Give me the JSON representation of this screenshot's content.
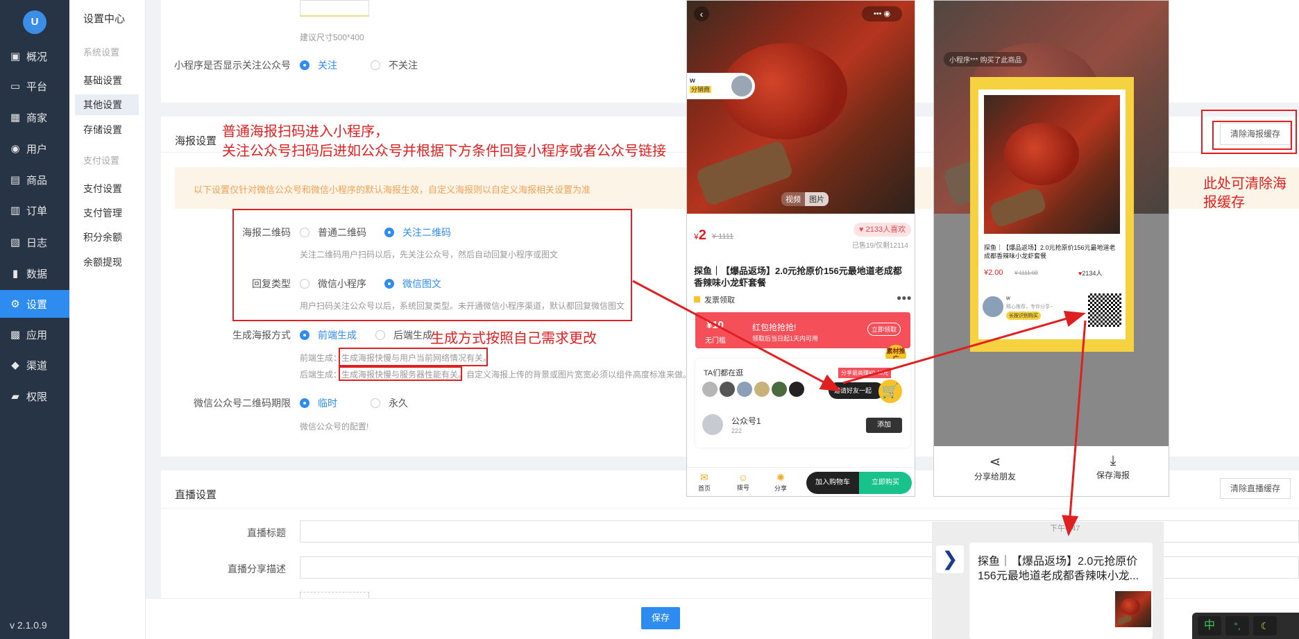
{
  "app": {
    "logo": "U",
    "version": "v 2.1.0.9"
  },
  "nav": [
    "概况",
    "平台",
    "商家",
    "用户",
    "商品",
    "订单",
    "日志",
    "数据",
    "设置",
    "应用",
    "渠道",
    "权限"
  ],
  "nav_icons": [
    "dashboard-icon",
    "monitor-icon",
    "store-icon",
    "user-icon",
    "goods-icon",
    "order-icon",
    "log-icon",
    "chart-icon",
    "gear-icon",
    "apps-icon",
    "cube-icon",
    "lock-icon"
  ],
  "sub": {
    "title": "设置中心",
    "group1": "系统设置",
    "items1": [
      "基础设置",
      "其他设置",
      "存储设置"
    ],
    "group2": "支付设置",
    "items2": [
      "支付设置",
      "支付管理",
      "积分余额",
      "余额提现"
    ]
  },
  "top": {
    "size_hint": "建议尺寸500*400",
    "follow_label": "小程序是否显示关注公众号",
    "follow_on": "关注",
    "follow_off": "不关注"
  },
  "poster": {
    "title": "海报设置",
    "clear_button": "清除海报缓存",
    "notice": "以下设置仅针对微信公众号和微信小程序的默认海报生效，自定义海报则以自定义海报相关设置为准",
    "qr_label": "海报二维码",
    "qr_opt1": "普通二维码",
    "qr_opt2": "关注二维码",
    "qr_hint": "关注二维码用户扫码以后，先关注公众号，然后自动回复小程序或图文",
    "reply_label": "回复类型",
    "reply_opt1": "微信小程序",
    "reply_opt2": "微信图文",
    "reply_hint": "用户扫码关注公众号以后，系统回复类型。未开通微信小程序渠道，默认都回复微信图文",
    "gen_label": "生成海报方式",
    "gen_opt1": "前端生成",
    "gen_opt2": "后端生成",
    "gen_hint1_prefix": "前端生成：",
    "gen_hint1": "生成海报快慢与用户当前网络情况有关。",
    "gen_hint2_prefix": "后端生成：",
    "gen_hint2": "生成海报快慢与服务器性能有关。",
    "gen_hint2_suffix": "自定义海报上传的背景或图片宽宽必须以组件高度标准来做。",
    "exp_label": "微信公众号二维码期限",
    "exp_opt1": "临时",
    "exp_opt2": "永久",
    "exp_hint": "微信公众号的配置!"
  },
  "live": {
    "title": "直播设置",
    "clear_button": "清除直播缓存",
    "title_label": "直播标题",
    "desc_label": "直播分享描述"
  },
  "save_button": "保存",
  "annotations": {
    "a1_line1": "普通海报扫码进入小程序，",
    "a1_line2": "关注公众号扫码后进如公众号并根据下方条件回复小程序或者公众号链接",
    "a2": "生成方式按照自己需求更改",
    "a3_line1": "此处可清除海",
    "a3_line2": "报缓存"
  },
  "phone1": {
    "user": "w",
    "tag": "分销商",
    "media_tabs": [
      "视频",
      "图片"
    ],
    "price_sym": "¥",
    "price": "2",
    "orig_price": "¥ 1111",
    "likes": "2133人喜欢",
    "sold": "已售19/仅剩12114",
    "product_title": "探鱼｜【爆品返场】2.0元抢原价156元最地道老成都香辣味小龙虾套餐",
    "invoice": "发票领取",
    "coupon_value": "¥10",
    "coupon_type": "无门槛",
    "coupon_title": "红包抢抢抢!",
    "coupon_desc": "领取后当日起1天内可用",
    "coupon_btn": "立即领取",
    "material": "素材推广",
    "others": "TA们都在逛",
    "share_earn": "分享最高赚¥0.40元",
    "invite": "邀请好友一起",
    "account": "公众号1",
    "account_num": "222",
    "add_btn": "添加",
    "bottom": [
      "首页",
      "拨号",
      "分享"
    ],
    "cart_btn": "加入购物车",
    "buy_btn": "立即购买"
  },
  "phone2": {
    "bought": "小程序*** 购买了此商品",
    "poster_title": "探鱼｜【爆品返场】2.0元抢原价156元最地道老成都香辣味小龙虾套餐",
    "poster_price": "¥2.00",
    "poster_orig": "¥ 1111.00",
    "poster_likes": "2134人",
    "poster_user": "w",
    "poster_slogan": "精心推荐，专你分享~",
    "poster_tip": "长按识别购买",
    "share_friend": "分享给朋友",
    "save_poster": "保存海报"
  },
  "chat": {
    "time": "下午4:47",
    "card_title": "探鱼｜【爆品返场】2.0元抢原价156元最地道老成都香辣味小龙..."
  },
  "ime": [
    "中",
    "°,",
    "☾"
  ]
}
